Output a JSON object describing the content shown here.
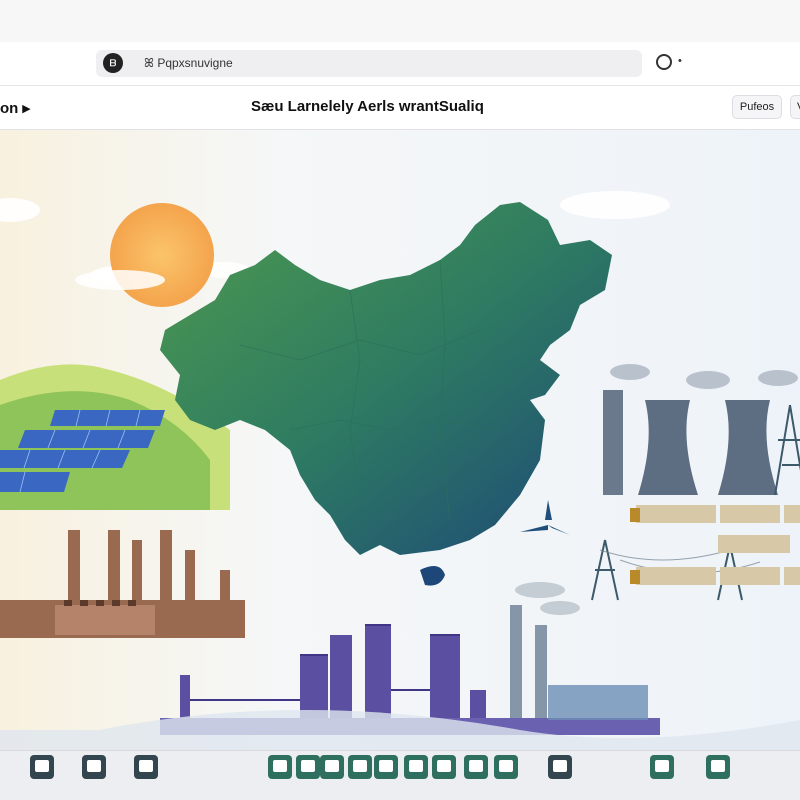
{
  "browser": {
    "site_icon": "ᗷ",
    "address_glyph": "ꕤ",
    "address_text": "ꕤ Pqpxsnuvigne",
    "globe_icon": "globe-icon",
    "menu_dot": "•"
  },
  "header": {
    "back_label": "on ▸",
    "title": "Sæu Larnelely Aerls wrantSualiq",
    "right_button": "Pufeos",
    "right_button_2": "V"
  },
  "scene": {
    "icons": [
      "sun-icon",
      "solar-panel-icon",
      "china-map-icon",
      "cooling-tower-icon",
      "transmission-tower-icon",
      "truck-icon",
      "factory-icon",
      "refinery-icon",
      "wind-turbine-icon"
    ],
    "colors": {
      "map_dark": "#1f4f7a",
      "map_green": "#3a8a5a",
      "sun": "#f4a44c",
      "factory_brown": "#9a6a50",
      "refinery_purple": "#5a4fa0"
    }
  },
  "dock": {
    "items": [
      "cpu-icon",
      "cpu-icon",
      "cpu-icon",
      "monitor-icon",
      "monitor-icon",
      "monitor-icon",
      "monitor-icon",
      "monitor-icon",
      "monitor-icon",
      "monitor-icon",
      "monitor-icon",
      "monitor-icon",
      "cpu-icon",
      "monitor-icon",
      "monitor-icon"
    ],
    "accent": "#2e6f5f"
  }
}
